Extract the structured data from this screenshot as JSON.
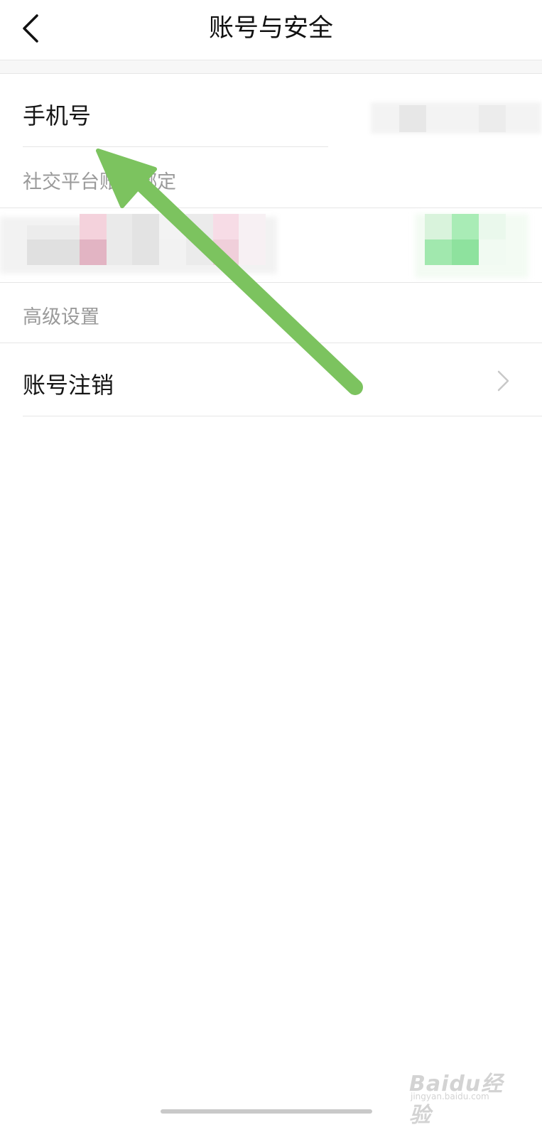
{
  "header": {
    "title": "账号与安全",
    "back_icon": "chevron-left-icon"
  },
  "rows": {
    "phone": {
      "label": "手机号"
    },
    "social_section": {
      "label": "社交平台账号绑定"
    },
    "advanced_section": {
      "label": "高级设置"
    },
    "cancel_account": {
      "label": "账号注销",
      "chevron_icon": "chevron-right-icon"
    }
  },
  "annotation": {
    "arrow_color": "#7cc35f",
    "points_to": "phone"
  },
  "watermark": {
    "brand": "Baidu经验",
    "url": "jingyan.baidu.com"
  },
  "colors": {
    "background": "#ffffff",
    "divider": "#e6e6e6",
    "primary_text": "#161616",
    "section_text": "#9a9a9a",
    "chevron": "#c8c8c8"
  }
}
